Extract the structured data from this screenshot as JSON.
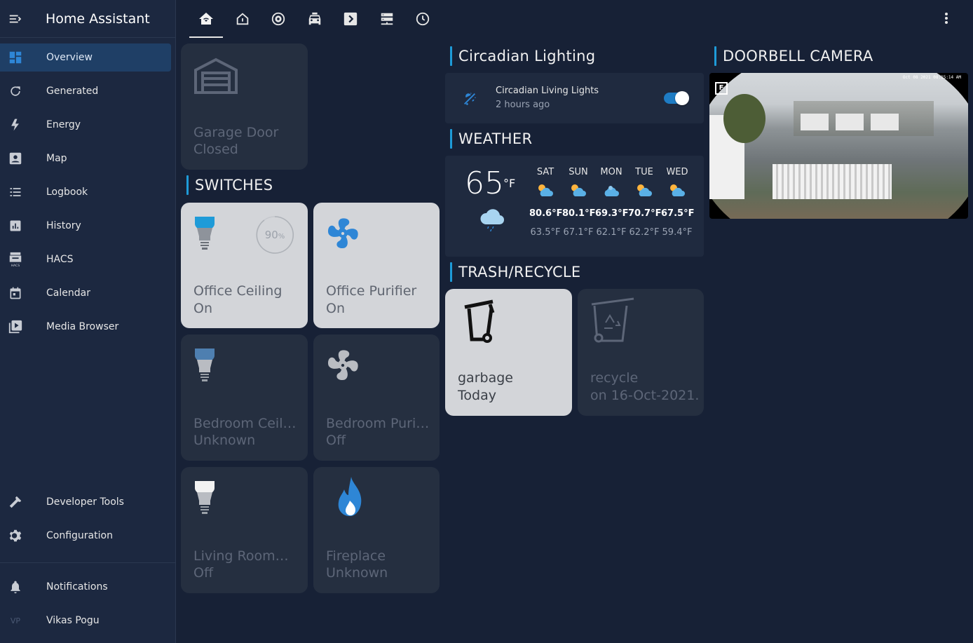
{
  "app": {
    "title": "Home Assistant"
  },
  "sidebar": {
    "items": [
      {
        "label": "Overview",
        "icon": "dashboard-icon"
      },
      {
        "label": "Generated",
        "icon": "refresh-icon"
      },
      {
        "label": "Energy",
        "icon": "lightning-icon"
      },
      {
        "label": "Map",
        "icon": "map-account-icon"
      },
      {
        "label": "Logbook",
        "icon": "list-icon"
      },
      {
        "label": "History",
        "icon": "chart-box-icon"
      },
      {
        "label": "HACS",
        "icon": "hacs-icon"
      },
      {
        "label": "Calendar",
        "icon": "calendar-icon"
      },
      {
        "label": "Media Browser",
        "icon": "play-box-icon"
      }
    ],
    "bottom_items": [
      {
        "label": "Developer Tools",
        "icon": "hammer-icon"
      },
      {
        "label": "Configuration",
        "icon": "gear-icon"
      }
    ],
    "notifications": "Notifications",
    "user": {
      "name": "Vikas Pogu",
      "initials": "VP"
    }
  },
  "topbar": {
    "tabs": [
      "home-wifi-icon",
      "home-outline-icon",
      "robot-vacuum-icon",
      "car-icon",
      "chevron-right-box-icon",
      "server-icon",
      "clock-icon"
    ]
  },
  "garage": {
    "name": "Garage Door",
    "state": "Closed"
  },
  "switches": {
    "title": "SWITCHES",
    "tiles": [
      {
        "name": "Office Ceiling",
        "state": "On",
        "brightness": "90",
        "unit": "%"
      },
      {
        "name": "Office Purifier",
        "state": "On"
      },
      {
        "name": "Bedroom Ceili...",
        "state": "Unknown"
      },
      {
        "name": "Bedroom Purif...",
        "state": "Off"
      },
      {
        "name": "Living Room ...",
        "state": "Off"
      },
      {
        "name": "Fireplace",
        "state": "Unknown"
      }
    ]
  },
  "circadian": {
    "title": "Circadian Lighting",
    "entity": "Circadian Living Lights",
    "time": "2 hours ago",
    "enabled": true
  },
  "weather": {
    "title": "WEATHER",
    "current_temp": "65",
    "unit": "°F",
    "forecast": [
      {
        "day": "SAT",
        "high": "80.6°F",
        "low": "63.5°F"
      },
      {
        "day": "SUN",
        "high": "80.1°F",
        "low": "67.1°F"
      },
      {
        "day": "MON",
        "high": "69.3°F",
        "low": "62.1°F"
      },
      {
        "day": "TUE",
        "high": "70.7°F",
        "low": "62.2°F"
      },
      {
        "day": "WED",
        "high": "67.5°F",
        "low": "59.4°F"
      }
    ]
  },
  "trash": {
    "title": "TRASH/RECYCLE",
    "tiles": [
      {
        "name": "garbage",
        "state": "Today"
      },
      {
        "name": "recycle",
        "state": "on 16-Oct-2021."
      }
    ]
  },
  "doorbell": {
    "title": "DOORBELL CAMERA",
    "timestamp": "Oct 08 2021  08:15:14 AM"
  },
  "colors": {
    "accent": "#1e9bd8",
    "bg": "#172136",
    "card": "#252f40",
    "tile_on": "#d3d5d9"
  }
}
